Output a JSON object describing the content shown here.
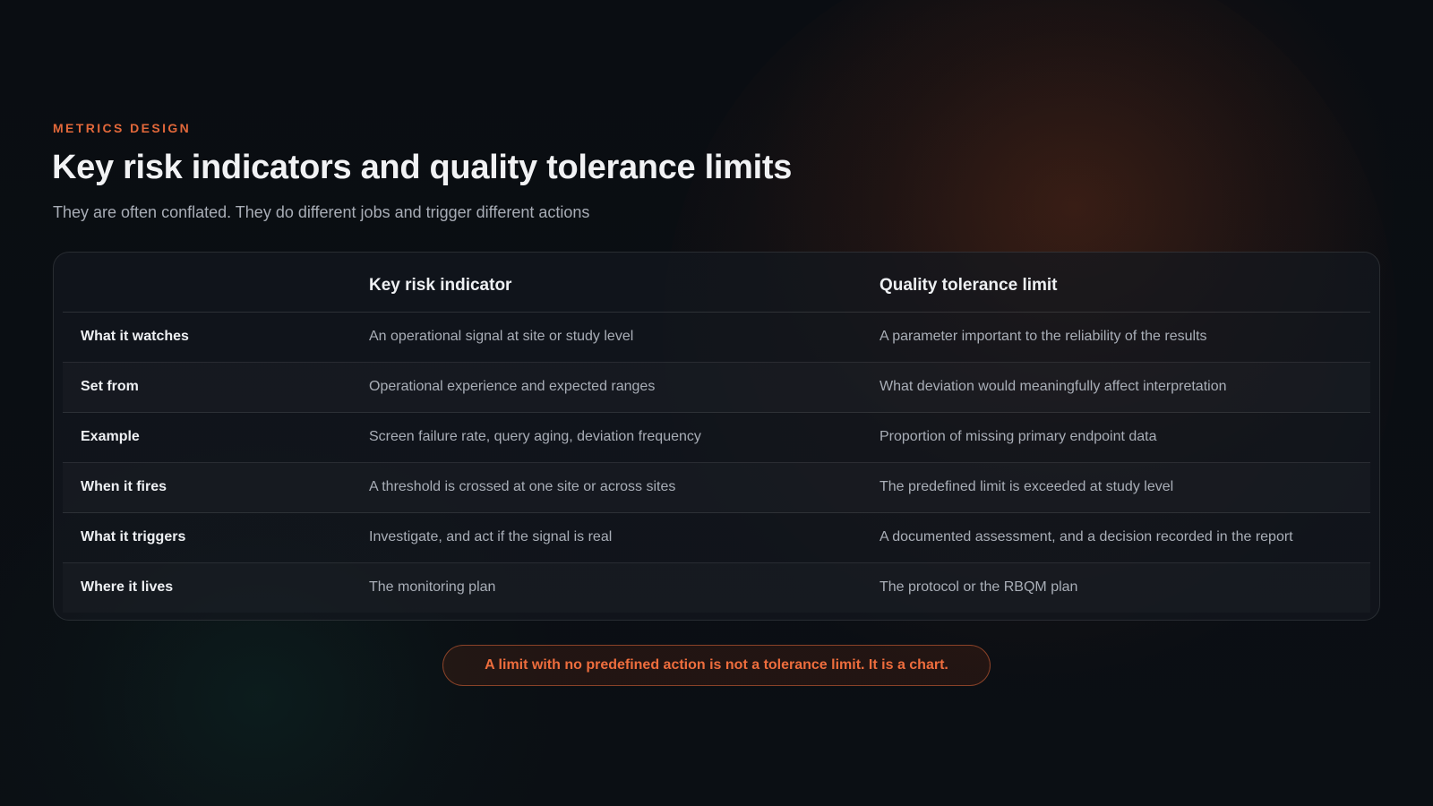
{
  "eyebrow": "METRICS DESIGN",
  "title": "Key risk indicators and quality tolerance limits",
  "subtitle": "They are often conflated. They do different jobs and trigger different actions",
  "table": {
    "columns": [
      "",
      "Key risk indicator",
      "Quality tolerance limit"
    ],
    "rows": [
      {
        "label": "What it watches",
        "kri": "An operational signal at site or study level",
        "qtl": "A parameter important to the reliability of the results"
      },
      {
        "label": "Set from",
        "kri": "Operational experience and expected ranges",
        "qtl": "What deviation would meaningfully affect interpretation"
      },
      {
        "label": "Example",
        "kri": "Screen failure rate, query aging, deviation frequency",
        "qtl": "Proportion of missing primary endpoint data"
      },
      {
        "label": "When it fires",
        "kri": "A threshold is crossed at one site or across sites",
        "qtl": "The predefined limit is exceeded at study level"
      },
      {
        "label": "What it triggers",
        "kri": "Investigate, and act if the signal is real",
        "qtl": "A documented assessment, and a decision recorded in the report"
      },
      {
        "label": "Where it lives",
        "kri": "The monitoring plan",
        "qtl": "The protocol or the RBQM plan"
      }
    ]
  },
  "callout": "A limit with no predefined action is not a tolerance limit. It is a chart.",
  "colors": {
    "accent": "#e2683a",
    "background": "#0a0d12",
    "heading": "#f1f2f4",
    "muted_text": "#a9aeb7"
  }
}
